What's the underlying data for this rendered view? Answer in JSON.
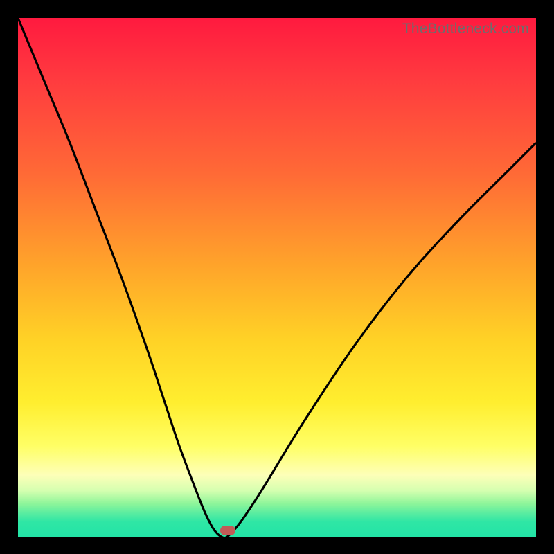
{
  "watermark": "TheBottleneck.com",
  "chart_data": {
    "type": "line",
    "title": "",
    "xlabel": "",
    "ylabel": "",
    "xlim": [
      0,
      100
    ],
    "ylim": [
      0,
      100
    ],
    "series": [
      {
        "name": "bottleneck-curve",
        "x": [
          0,
          5,
          10,
          15,
          20,
          25,
          28,
          31,
          34,
          36,
          37.5,
          38.5,
          39.5,
          40.2,
          41,
          43,
          47,
          55,
          65,
          75,
          85,
          95,
          100
        ],
        "y": [
          100,
          88,
          76,
          63,
          50,
          36,
          27,
          18,
          10,
          5,
          2,
          0.7,
          0,
          0,
          0.7,
          3,
          9,
          22,
          37,
          50,
          61,
          71,
          76
        ]
      }
    ],
    "marker": {
      "x": 40.5,
      "y": 1.3
    },
    "gradient_stops": [
      {
        "pct": 0,
        "color": "#ff1a3f"
      },
      {
        "pct": 12,
        "color": "#ff3b3f"
      },
      {
        "pct": 30,
        "color": "#ff6a36"
      },
      {
        "pct": 48,
        "color": "#ffa52a"
      },
      {
        "pct": 62,
        "color": "#ffd226"
      },
      {
        "pct": 74,
        "color": "#ffee2f"
      },
      {
        "pct": 82.5,
        "color": "#ffff66"
      },
      {
        "pct": 88,
        "color": "#fdffb8"
      },
      {
        "pct": 91,
        "color": "#d5ffb0"
      },
      {
        "pct": 93.5,
        "color": "#8ef59a"
      },
      {
        "pct": 95.5,
        "color": "#55eca1"
      },
      {
        "pct": 97,
        "color": "#2fe6a5"
      },
      {
        "pct": 100,
        "color": "#22e4a6"
      }
    ]
  }
}
